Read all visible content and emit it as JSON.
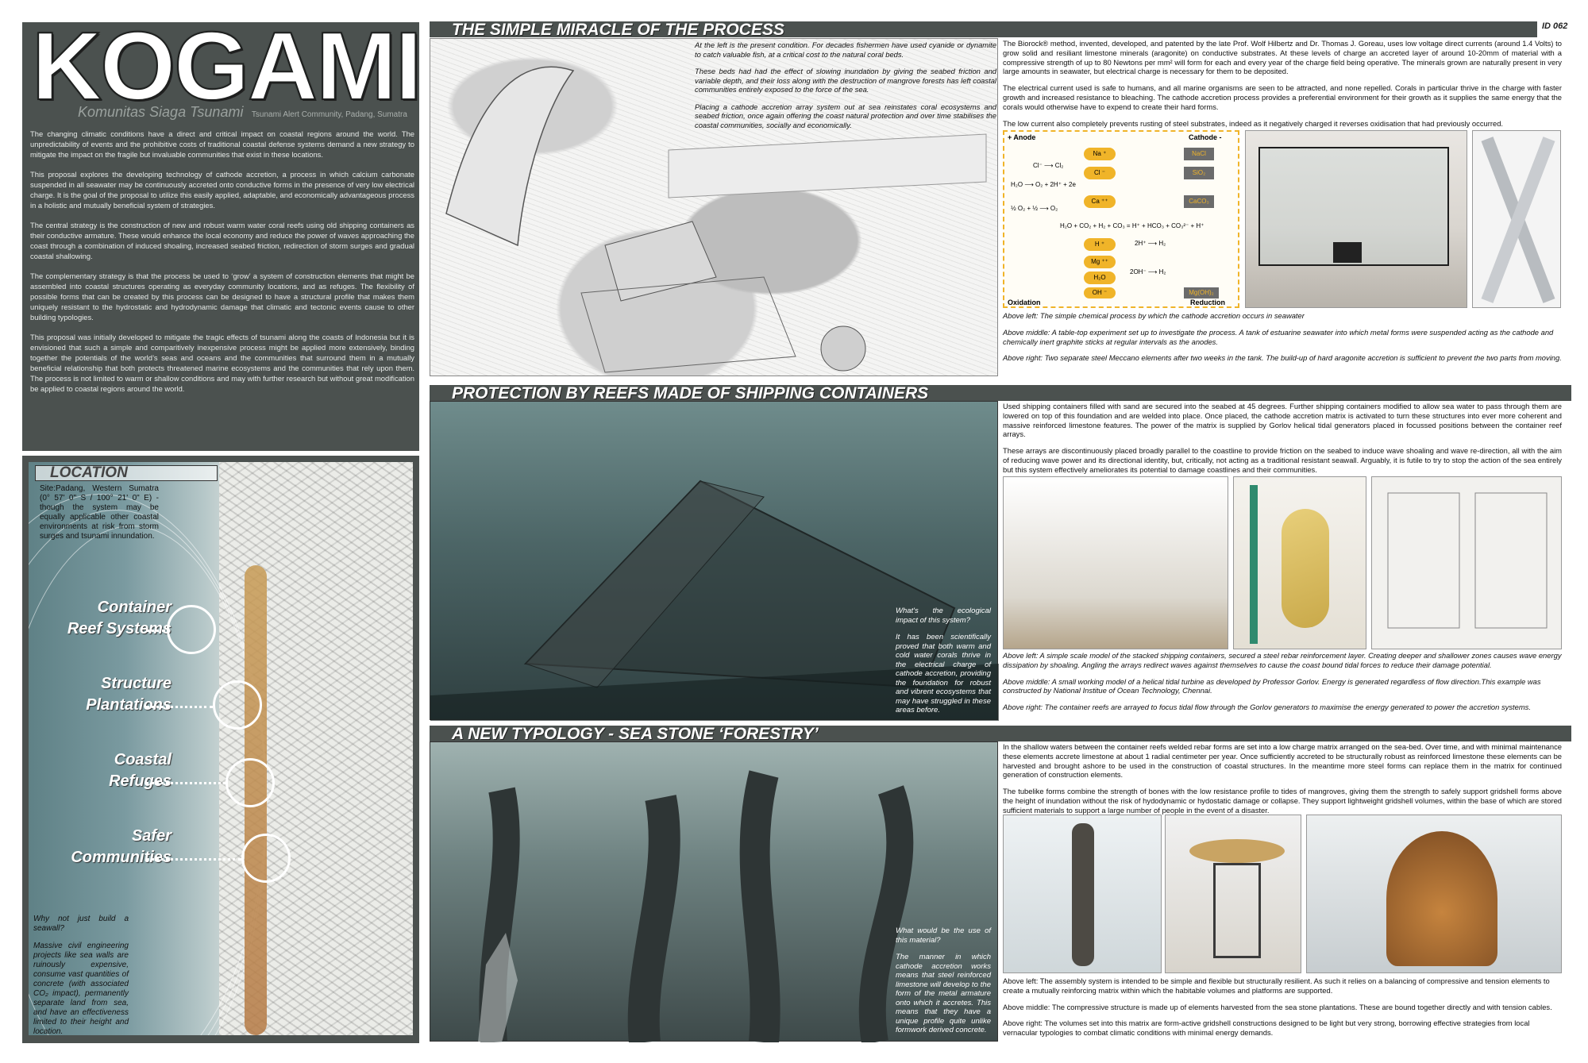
{
  "title": "KOGAMI",
  "subtitle": "Komunitas Siaga Tsunami",
  "subtitle_note": "Tsunami Alert Community, Padang, Sumatra",
  "id_tag": "ID 062",
  "intro": [
    "The changing climatic conditions have a direct and critical impact on coastal regions around the world. The unpredictability of events and the prohibitive costs of traditional coastal defense systems demand a new strategy to mitigate the impact on the fragile but invaluable communities that exist in these locations.",
    "This proposal explores the developing technology of cathode accretion, a process in which calcium carbonate suspended in all seawater may be continuously accreted onto conductive forms in the presence of very low electrical charge. It is the goal of the proposal to utilize this easily applied, adaptable, and economically advantageous process in a holistic and mutually beneficial system of strategies.",
    "The central strategy is the construction of new and robust warm water coral reefs using old shipping containers as their conductive armature. These would enhance the local economy and reduce the power of waves approaching the coast through a combination of induced shoaling, increased seabed friction, redirection of storm surges and gradual coastal shallowing.",
    "The complementary strategy is that the process be used to ‘grow’ a system of construction elements that might be assembled into coastal structures operating as everyday community locations, and as refuges. The flexibility of possible forms that can be created by this process can be designed to have a structural profile that makes them uniquely resistant to the hydrostatic and hydrodynamic damage that climatic and tectonic events cause to other building typologies.",
    "This proposal was initially developed to mitigate the tragic effects of tsunami along the coasts of Indonesia but it is envisioned that such a simple and comparitively inexpensive process might be applied more extensively, binding together the potentials of the world’s seas and oceans and the communities that surround them in a mutually beneficial relationship that both protects threatened marine ecosystems and the communities that rely upon them. The process is not limited to warm or shallow conditions and may with further research but without great modification be applied to coastal regions around the world."
  ],
  "location": {
    "title": "LOCATION",
    "site": "Site:Padang, Western Sumatra (0° 57' 0\" S / 100° 21' 0\" E) - though the system may be equally applicable other coastal environments at risk from storm surges and tsunami innundation.",
    "zones": [
      {
        "line1": "Container",
        "line2": "Reef Systems"
      },
      {
        "line1": "Structure",
        "line2": "Plantations"
      },
      {
        "line1": "Coastal",
        "line2": "Refuges"
      },
      {
        "line1": "Safer",
        "line2": "Communities"
      }
    ],
    "why_question": "Why not just build a seawall?",
    "why_answer": "Massive civil engineering projects like sea walls are ruinously expensive, consume vast quantities of concrete (with associated CO₂ impact), permanently separate land from sea, and have an effectiveness limited to their height and location."
  },
  "sections": {
    "process": {
      "title": "THE SIMPLE MIRACLE OF THE PROCESS",
      "sketch_text": [
        "At the left is the present condition. For decades fishermen have used cyanide or dynamite to catch valuable fish, at a critical cost to the natural coral beds.",
        "These beds had had the effect of slowing inundation by giving the seabed friction and variable depth, and their loss along with the destruction of mangrove forests has left coastal communities entirely exposed to the force of the sea.",
        "Placing a cathode accretion array system out at sea reinstates coral ecosystems and seabed friction, once again offering the coast natural protection and over time stabilises the coastal communities, socially and economically."
      ],
      "text": [
        "The Biorock® method, invented, developed, and patented by the late Prof. Wolf Hilbertz and Dr. Thomas J. Goreau, uses low voltage direct currents (around 1.4 Volts) to grow solid and resiliant limestone minerals (aragonite) on conductive substrates. At these levels of charge an accreted layer of around 10-20mm of material with a compressive strength of up to 80 Newtons per mm² will form for each and every year of the charge field being operative. The minerals grown are naturally present in very large amounts in seawater, but electrical charge is necessary for them to be deposited.",
        "The electrical current used is safe to humans, and all marine organisms are seen to be attracted, and none repelled. Corals in particular thrive in the charge with faster growth and increased resistance to bleaching. The cathode accretion process provides a preferential environment for their growth as it supplies the same energy that the corals would otherwise have to expend to create their hard forms.",
        "The low current also completely prevents rusting of steel substrates, indeed as it negatively charged it reverses oxidisation that had previously occurred."
      ],
      "diagram": {
        "anode": "+ Anode",
        "cathode": "Cathode -",
        "oxidation": "Oxidation",
        "reduction": "Reduction",
        "ions_left": [
          "Na ⁺",
          "Cl ⁻",
          "Ca ⁺⁺",
          "H ⁺",
          "Mg ⁺⁺",
          "H₂O",
          "OH ⁻"
        ],
        "products": [
          "NaCl",
          "SiO₂",
          "CaCO₃",
          "Mg(OH)₂"
        ],
        "eq1": "Cl⁻ ⟶ Cl₂",
        "eq2": "H₂O ⟶ O₂ + 2H⁺ + 2e",
        "eq3": "½ O₂ + ½ ⟶ O₂",
        "eq4": "H₂O + CO₂ + H₂ + CO₃ = H⁺ + HCO₃ + CO₃²⁻ + H⁺",
        "eq5": "2H⁺ ⟶ H₂",
        "eq6": "2OH⁻ ⟶ H₂"
      },
      "captions": [
        "Above left: The simple chemical process by which the cathode accretion occurs in seawater",
        "Above middle: A table-top experiment set up to investigate the process. A tank of estuarine seawater into which metal forms were suspended acting as the cathode and chemically inert graphite sticks at regular intervals as the anodes.",
        "Above right: Two separate steel Meccano elements after two weeks in the tank. The build-up of hard aragonite accretion is sufficient to prevent the two parts from moving."
      ]
    },
    "reefs": {
      "title": "PROTECTION BY REEFS MADE OF SHIPPING CONTAINERS",
      "overlay": [
        "What's the ecological impact of this system?",
        "It has been scientifically proved that both warm and cold water corals thrive in the electrical charge of cathode accretion, providing the foundation for robust and vibrent ecosystems that may have struggled in these areas before."
      ],
      "text": [
        "Used shipping containers filled with sand are secured into the seabed at 45 degrees. Further shipping containers modified to allow sea water to pass through them are lowered on top of this foundation and are welded into place. Once placed, the cathode accretion matrix is activated to turn these structures into ever more coherent and massive reinforced limestone features. The power of the matrix is supplied by Gorlov helical tidal generators placed in focussed positions between the container reef arrays.",
        "These arrays are discontinuously placed broadly parallel to the coastline to provide friction on the seabed to induce wave shoaling and wave re-direction, all with the aim of reducing wave power and its directional identity, but, critically, not acting as a traditional resistant seawall. Arguably, it is futile to try to stop the action of the sea entirely but this system effectively ameliorates its potential to damage coastlines and their communities."
      ],
      "captions": [
        "Above left: A simple scale model of the stacked shipping containers, secured a steel rebar reinforcement layer. Creating deeper and shallower zones causes wave energy dissipation by shoaling. Angling the arrays redirect waves against themselves to cause the coast bound tidal forces to reduce their damage potential.",
        "Above middle: A small working model of a helical tidal turbine as developed by Professor Gorlov. Energy is generated regardless of flow direction.This example was constructed by National Institue of Ocean Technology, Chennai.",
        "Above right: The container reefs are arrayed to focus tidal flow through the Gorlov generators to maximise the energy generated to power the accretion systems."
      ]
    },
    "forestry": {
      "title": "A NEW TYPOLOGY - SEA STONE ‘FORESTRY’",
      "overlay": [
        "What would be the use of this material?",
        "The manner in which cathode accretion works means that steel reinforced limestone will develop to the form of the metal armature onto which it accretes. This means that they have a unique profile quite unlike formwork derived concrete."
      ],
      "text": [
        "In the shallow waters between the container reefs welded rebar forms are set into a low charge matrix arranged on the sea-bed. Over time, and with minimal maintenance these elements accrete limestone at about 1 radial centimeter per year. Once sufficiently accreted to be structurally robust as reinforced limestone these elements can be harvested and brought ashore to be used in the construction of coastal structures. In the meantime more steel forms can replace them in the matrix for continued generation of construction elements.",
        "The tubelike forms combine the strength of bones with the low resistance profile to tides of mangroves, giving them the strength to safely support gridshell forms above the height of inundation without the risk of hydodynamic or hydostatic damage or collapse. They support lightweight gridshell volumes, within the base of which are stored sufficient materials to support a large number of people in the event of a disaster."
      ],
      "captions": [
        "Above left: The assembly system is intended to be simple and flexible but structurally resilient. As such it relies on a balancing of compressive and tension elements to create a mutually reinforcing matrix within which the habitable volumes and platforms are supported.",
        "Above middle: The compressive structure is made up of elements harvested from the sea stone plantations. These are bound together directly and with tension cables.",
        "Above right: The volumes set into this matrix are form-active gridshell constructions designed to be light but very strong, borrowing effective strategies from local vernacular typologies to combat climatic conditions with minimal energy demands."
      ]
    }
  },
  "colors": {
    "panel": "#4b514f",
    "ion_orange": "#f0b429",
    "product_grey": "#6b6b6b"
  }
}
